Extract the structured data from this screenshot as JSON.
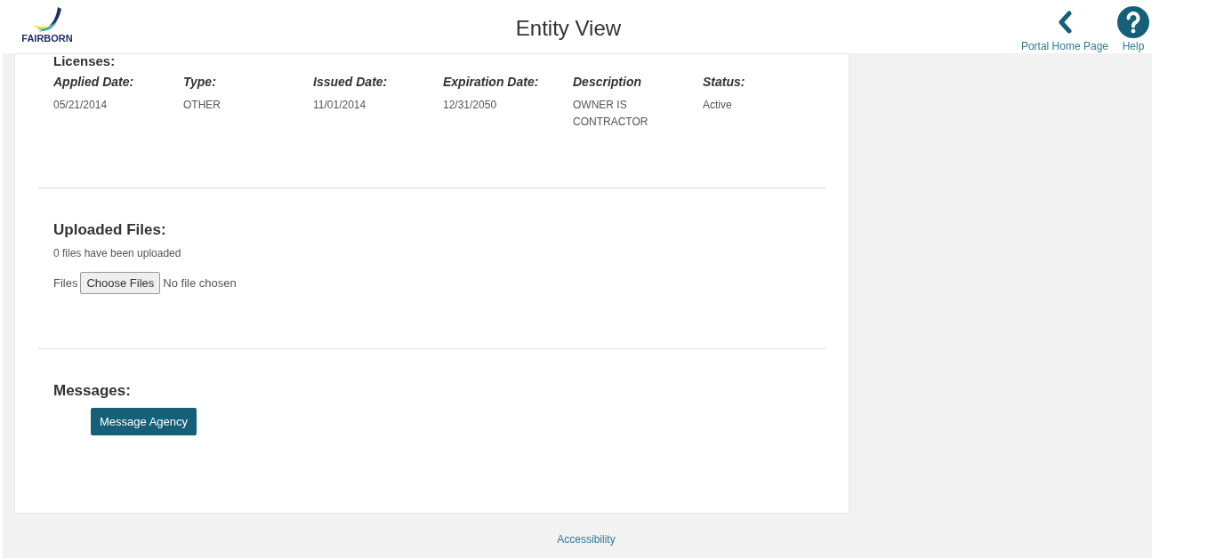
{
  "header": {
    "logo_text": "FAIRBORN",
    "title": "Entity View",
    "nav": [
      {
        "kind": "back",
        "label": "Portal Home Page"
      },
      {
        "kind": "help",
        "label": "Help"
      }
    ]
  },
  "licenses": {
    "heading": "Licenses:",
    "columns": [
      "Applied Date:",
      "Type:",
      "Issued Date:",
      "Expiration Date:",
      "Description",
      "Status:"
    ],
    "rows": [
      [
        "05/21/2014",
        "OTHER",
        "11/01/2014",
        "12/31/2050",
        "OWNER IS CONTRACTOR",
        "Active"
      ]
    ]
  },
  "uploaded_files": {
    "heading": "Uploaded Files:",
    "count_text": "0 files have been uploaded",
    "field_label": "Files",
    "button": "Choose Files",
    "status": "No file chosen"
  },
  "messages": {
    "heading": "Messages:",
    "button": "Message Agency"
  },
  "footer": {
    "link": "Accessibility"
  }
}
